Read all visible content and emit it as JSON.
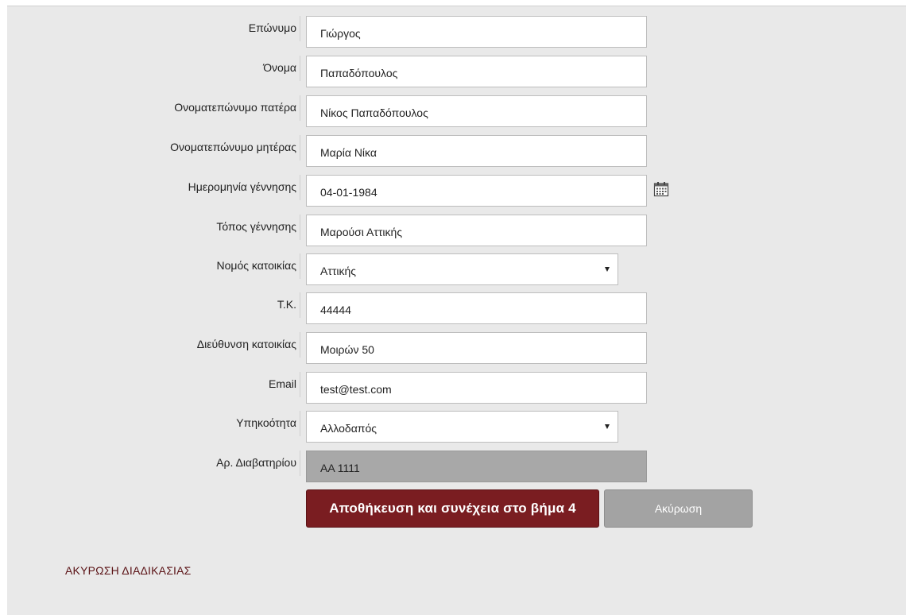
{
  "form": {
    "fields": [
      {
        "label": "Επώνυμο",
        "value": "Γιώργος"
      },
      {
        "label": "Όνομα",
        "value": "Παπαδόπουλος"
      },
      {
        "label": "Ονοματεπώνυμο πατέρα",
        "value": "Νίκος Παπαδόπουλος"
      },
      {
        "label": "Ονοματεπώνυμο μητέρας",
        "value": "Μαρία Νίκα"
      },
      {
        "label": "Ημερομηνία γέννησης",
        "value": "04-01-1984"
      },
      {
        "label": "Τόπος γέννησης",
        "value": "Μαρούσι Αττικής"
      },
      {
        "label": "Νομός κατοικίας",
        "value": "Αττικής"
      },
      {
        "label": "Τ.Κ.",
        "value": "44444"
      },
      {
        "label": "Διεύθυνση κατοικίας",
        "value": "Μοιρών 50"
      },
      {
        "label": "Email",
        "value": "test@test.com"
      },
      {
        "label": "Υπηκοότητα",
        "value": "Αλλοδαπός"
      },
      {
        "label": "Αρ. Διαβατηρίου",
        "value": "AA 1111"
      }
    ]
  },
  "icons": {
    "calendar": "calendar-icon",
    "dropdown": "chevron-down-icon"
  },
  "actions": {
    "save_label": "Αποθήκευση και συνέχεια στο βήμα 4",
    "cancel_label": "Ακύρωση",
    "abort_label": "ΑΚΥΡΩΣΗ ΔΙΑΔΙΚΑΣΙΑΣ"
  },
  "colors": {
    "primary": "#7a1d21",
    "secondary": "#a3a3a3",
    "disabled_field": "#a8a8a8",
    "background": "#e9e9e9"
  }
}
